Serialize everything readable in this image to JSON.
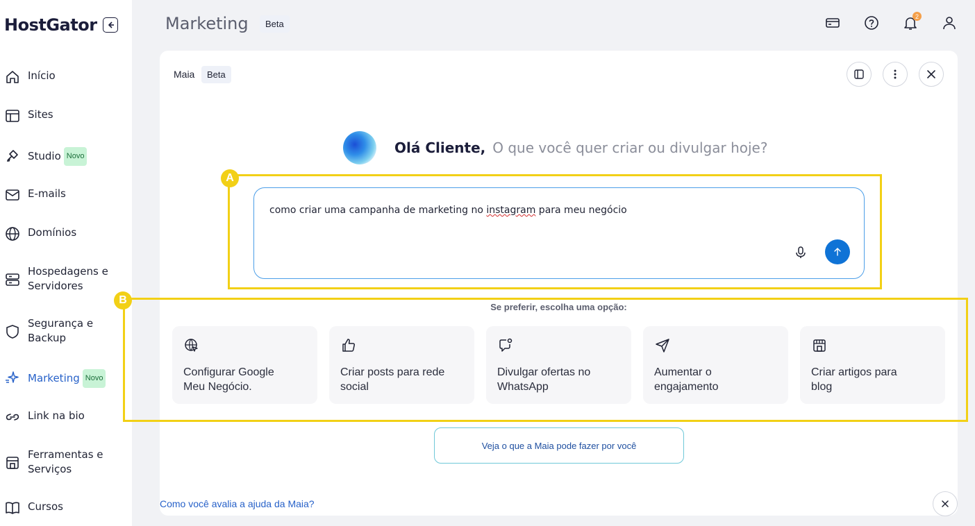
{
  "brand": {
    "name": "HostGator"
  },
  "sidebar": {
    "items": [
      {
        "label": "Início"
      },
      {
        "label": "Sites"
      },
      {
        "label": "Studio",
        "badge": "Novo"
      },
      {
        "label": "E-mails"
      },
      {
        "label": "Domínios"
      },
      {
        "label_line1": "Hospedagens e",
        "label_line2": "Servidores"
      },
      {
        "label_line1": "Segurança e",
        "label_line2": "Backup"
      },
      {
        "label": "Marketing",
        "badge": "Novo",
        "active": true
      },
      {
        "label": "Link na bio"
      },
      {
        "label_line1": "Ferramentas e",
        "label_line2": "Serviços"
      },
      {
        "label": "Cursos"
      }
    ]
  },
  "header": {
    "title": "Marketing",
    "badge": "Beta",
    "notification_count": "2"
  },
  "assistant": {
    "name": "Maia",
    "badge": "Beta",
    "greeting_name": "Olá Cliente,",
    "greeting_question": "O que você quer criar ou divulgar hoje?",
    "input": {
      "text_before": "como criar uma campanha de marketing no ",
      "text_misspelled": "instagram",
      "text_after": " para meu negócio"
    },
    "prefer_label": "Se preferir, escolha uma opção:",
    "options": [
      {
        "line1": "Configurar Google",
        "line2": "Meu Negócio.",
        "icon": "globe-cursor-icon"
      },
      {
        "line1": "Criar posts para rede",
        "line2": "social",
        "icon": "thumbs-up-icon"
      },
      {
        "line1": "Divulgar ofertas no",
        "line2": "WhatsApp",
        "icon": "chat-bubble-icon"
      },
      {
        "line1": "Aumentar o",
        "line2": "engajamento",
        "icon": "send-arrow-icon"
      },
      {
        "line1": "Criar artigos para",
        "line2": "blog",
        "icon": "storefront-icon"
      }
    ],
    "see_more": "Veja o que a Maia pode fazer por você",
    "rate_prompt": "Como você avalia a ajuda da Maia?"
  },
  "annotations": {
    "a": "A",
    "b": "B"
  },
  "colors": {
    "accent": "#0f73d6",
    "active_nav": "#2862c9",
    "annotation": "#f2d016",
    "badge_novo": "#c8f3d6"
  }
}
